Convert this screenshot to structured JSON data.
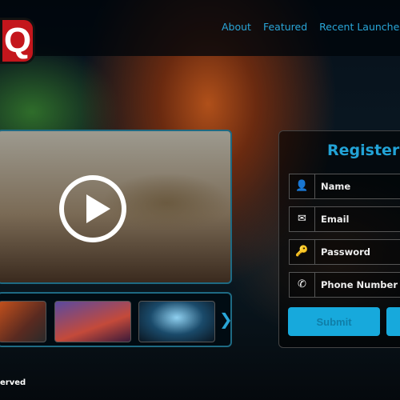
{
  "logo": {
    "text": "Q"
  },
  "nav": {
    "items": [
      "About",
      "Featured",
      "Recent Launches"
    ]
  },
  "video": {
    "play_icon": "play-icon"
  },
  "carousel": {
    "next_icon": "chevron-right-icon"
  },
  "register": {
    "title": "Register",
    "fields": [
      {
        "label": "Name",
        "icon": "user-icon"
      },
      {
        "label": "Email",
        "icon": "envelope-icon"
      },
      {
        "label": "Password",
        "icon": "key-lock-icon"
      },
      {
        "label": "Phone Number",
        "icon": "phone-icon"
      }
    ],
    "submit": "Submit"
  },
  "footer": {
    "text": "erved"
  }
}
